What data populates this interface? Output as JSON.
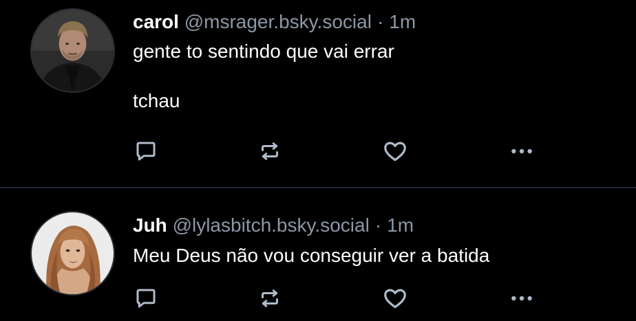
{
  "posts": [
    {
      "display_name": "carol",
      "handle": "@msrager.bsky.social",
      "separator": "·",
      "time": "1m",
      "text": "gente to sentindo que vai errar\n\ntchau",
      "avatar": "man-portrait-avatar"
    },
    {
      "display_name": "Juh",
      "handle": "@lylasbitch.bsky.social",
      "separator": "·",
      "time": "1m",
      "text": "Meu Deus não vou conseguir ver a batida",
      "avatar": "woman-portrait-avatar"
    }
  ],
  "icons": {
    "reply": "reply-icon",
    "repost": "repost-icon",
    "like": "heart-icon",
    "more": "more-options-icon"
  },
  "colors": {
    "background": "#000000",
    "text": "#ffffff",
    "muted": "#8b98a5",
    "icon": "#aebbc9",
    "divider": "#1f2630"
  }
}
